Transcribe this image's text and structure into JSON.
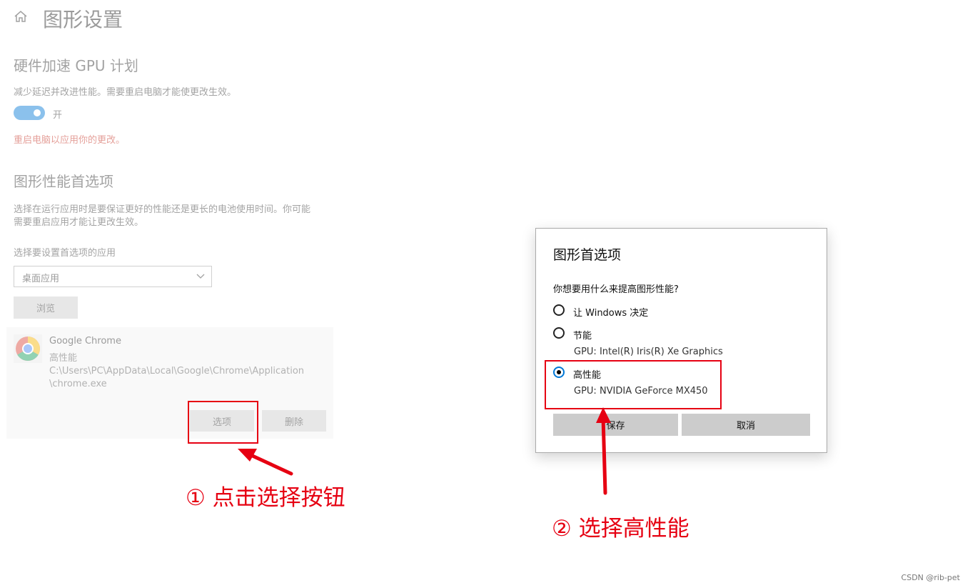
{
  "page": {
    "title": "图形设置",
    "hw_section_title": "硬件加速 GPU 计划",
    "hw_desc": "减少延迟并改进性能。需要重启电脑才能使更改生效。",
    "toggle_label": "开",
    "toggle_on": true,
    "restart_note": "重启电脑以应用你的更改。",
    "perf_section_title": "图形性能首选项",
    "perf_desc_line1": "选择在运行应用时是要保证更好的性能还是更长的电池使用时间。你可能",
    "perf_desc_line2": "需要重启应用才能让更改生效。",
    "select_label": "选择要设置首选项的应用",
    "select_value": "桌面应用",
    "browse_label": "浏览"
  },
  "app": {
    "name": "Google Chrome",
    "preference": "高性能",
    "path_line1": "C:\\Users\\PC\\AppData\\Local\\Google\\Chrome\\Application",
    "path_line2": "\\chrome.exe",
    "options_label": "选项",
    "remove_label": "删除"
  },
  "dialog": {
    "title": "图形首选项",
    "question": "你想要用什么来提高图形性能?",
    "options": [
      {
        "label": "让 Windows 决定",
        "sub": "",
        "selected": false
      },
      {
        "label": "节能",
        "sub": "GPU: Intel(R) Iris(R) Xe Graphics",
        "selected": false
      },
      {
        "label": "高性能",
        "sub": "GPU: NVIDIA GeForce MX450",
        "selected": true
      }
    ],
    "save_label": "保存",
    "cancel_label": "取消"
  },
  "annotations": {
    "step1": "① 点击选择按钮",
    "step2": "② 选择高性能",
    "color": "#e60012"
  },
  "watermark": "CSDN @rib-pet",
  "colors": {
    "accent": "#0078d7",
    "warning": "#c42b1c",
    "annotation": "#e60012"
  }
}
